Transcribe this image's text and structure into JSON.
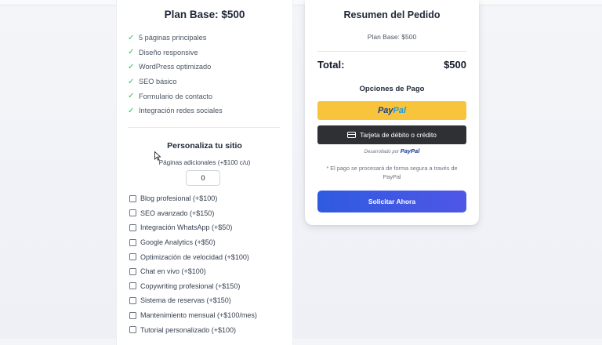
{
  "plan": {
    "title": "Plan Base: $500",
    "features": [
      "5 páginas principales",
      "Diseño responsive",
      "WordPress optimizado",
      "SEO básico",
      "Formulario de contacto",
      "Integración redes sociales"
    ]
  },
  "customize": {
    "title": "Personaliza tu sitio",
    "pages_label": "Páginas adicionales (+$100 c/u)",
    "pages_value": "0",
    "addons": [
      "Blog profesional (+$100)",
      "SEO avanzado (+$150)",
      "Integración WhatsApp (+$50)",
      "Google Analytics (+$50)",
      "Optimización de velocidad (+$100)",
      "Chat en vivo (+$100)",
      "Copywriting profesional (+$150)",
      "Sistema de reservas (+$150)",
      "Mantenimiento mensual (+$100/mes)",
      "Tutorial personalizado (+$100)"
    ]
  },
  "summary": {
    "title": "Resumen del Pedido",
    "plan_line": "Plan Base: $500",
    "total_label": "Total:",
    "total_value": "$500",
    "payment_title": "Opciones de Pago",
    "paypal_part1": "Pay",
    "paypal_part2": "Pal",
    "card_button": "Tarjeta de débito o crédito",
    "powered_text": "Desarrollado por",
    "powered_brand": "PayPal",
    "note": "* El pago se procesará de forma segura a través de PayPal",
    "request_button": "Solicitar Ahora"
  },
  "colors": {
    "check": "#22c55e",
    "paypal_yellow": "#f7c43b",
    "request_blue": "#2f5be0"
  }
}
